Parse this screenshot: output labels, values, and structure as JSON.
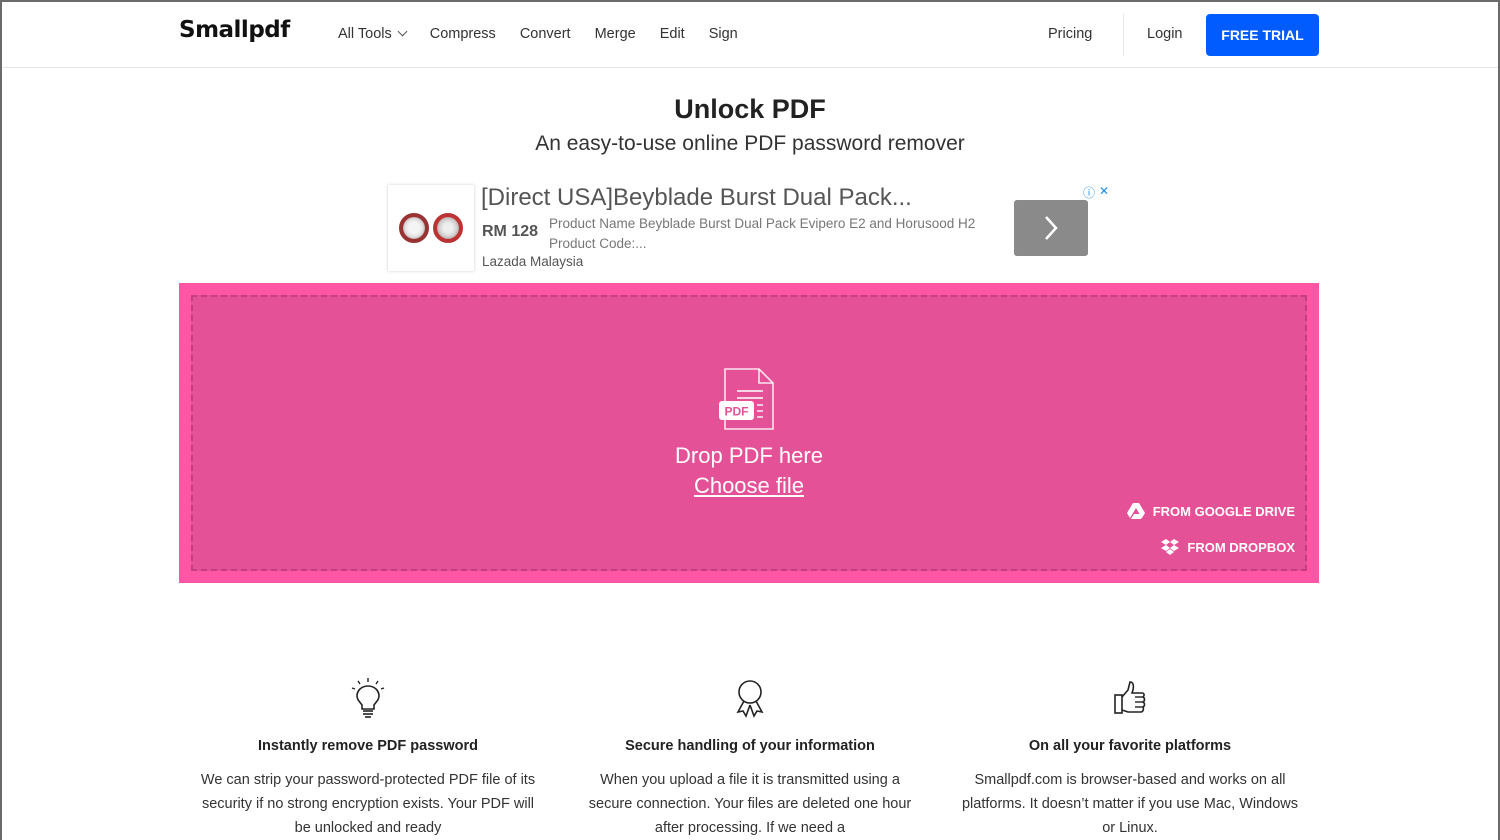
{
  "header": {
    "logo": "Smallpdf",
    "nav": [
      {
        "label": "All Tools",
        "has_dropdown": true
      },
      {
        "label": "Compress"
      },
      {
        "label": "Convert"
      },
      {
        "label": "Merge"
      },
      {
        "label": "Edit"
      },
      {
        "label": "Sign"
      }
    ],
    "pricing": "Pricing",
    "login": "Login",
    "free_trial": "FREE TRIAL"
  },
  "page": {
    "title": "Unlock PDF",
    "subtitle": "An easy-to-use online PDF password remover"
  },
  "ad": {
    "title": "[Direct USA]Beyblade Burst Dual Pack...",
    "price": "RM 128",
    "description": "Product Name Beyblade Burst Dual Pack Evipero E2 and Horusood H2 Product Code:...",
    "seller": "Lazada Malaysia",
    "info_icon": "ⓘ",
    "close_icon": "✕"
  },
  "dropzone": {
    "icon_label": "PDF",
    "drop_text": "Drop PDF here",
    "choose_file": "Choose file",
    "google_drive": "FROM GOOGLE DRIVE",
    "dropbox": "FROM DROPBOX",
    "colors": {
      "outer": "#ff55a5",
      "inner": "#e55197"
    }
  },
  "features": [
    {
      "icon": "lightbulb-icon",
      "title": "Instantly remove PDF password",
      "text": "We can strip your password-protected PDF file of its security if no strong encryption exists. Your PDF will be unlocked and ready"
    },
    {
      "icon": "award-ribbon-icon",
      "title": "Secure handling of your information",
      "text": "When you upload a file it is transmitted using a secure connection. Your files are deleted one hour after processing. If we need a"
    },
    {
      "icon": "thumbs-up-icon",
      "title": "On all your favorite platforms",
      "text": "Smallpdf.com is browser-based and works on all platforms. It doesn’t matter if you use Mac, Windows or Linux."
    }
  ]
}
